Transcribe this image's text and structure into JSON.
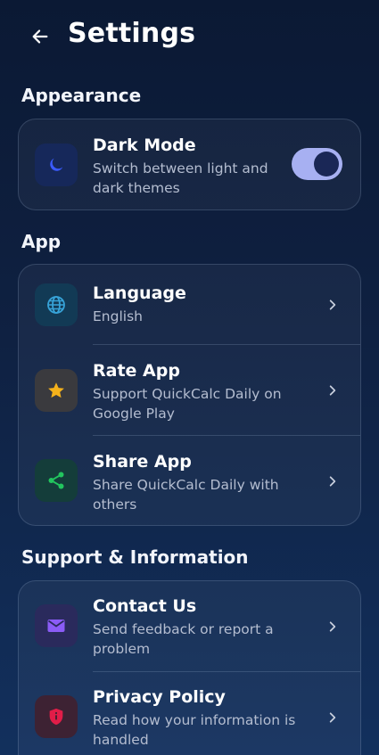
{
  "header": {
    "title": "Settings"
  },
  "sections": [
    {
      "title": "Appearance"
    },
    {
      "title": "App"
    },
    {
      "title": "Support & Information"
    }
  ],
  "appearance": {
    "dark_mode": {
      "title": "Dark Mode",
      "subtitle": "Switch between light and dark themes",
      "enabled": true,
      "icon": "moon-icon"
    }
  },
  "app": {
    "language": {
      "title": "Language",
      "subtitle": "English",
      "icon": "globe-icon"
    },
    "rate": {
      "title": "Rate App",
      "subtitle": "Support QuickCalc Daily on Google Play",
      "icon": "star-icon"
    },
    "share": {
      "title": "Share App",
      "subtitle": "Share QuickCalc Daily with others",
      "icon": "share-icon"
    }
  },
  "support": {
    "contact": {
      "title": "Contact Us",
      "subtitle": "Send feedback or report a problem",
      "icon": "mail-icon"
    },
    "privacy": {
      "title": "Privacy Policy",
      "subtitle": "Read how your information is handled",
      "icon": "shield-icon"
    }
  },
  "colors": {
    "moon": "#3b5bff",
    "globe": "#37a3d8",
    "star": "#f5b21b",
    "share": "#22c55e",
    "mail": "#8b5cf6",
    "shield": "#e11d48",
    "toggle_track": "#a7b0f2"
  }
}
